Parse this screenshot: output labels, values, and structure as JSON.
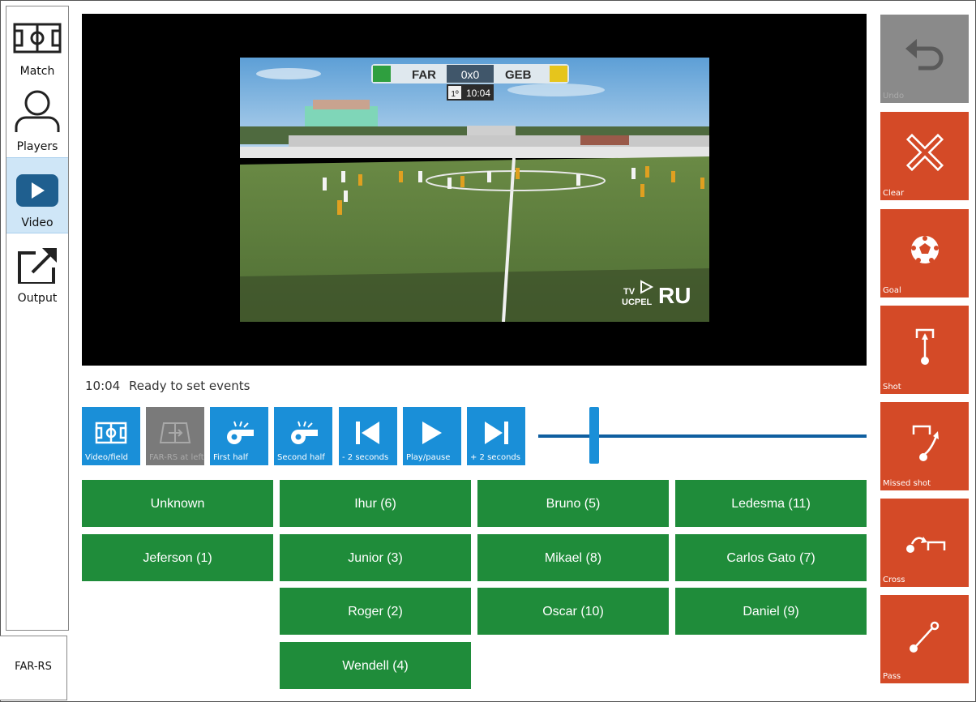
{
  "nav": {
    "items": [
      {
        "label": "Match",
        "icon": "field-icon"
      },
      {
        "label": "Players",
        "icon": "person-icon"
      },
      {
        "label": "Video",
        "icon": "play-icon"
      },
      {
        "label": "Output",
        "icon": "export-icon"
      }
    ],
    "team": "FAR-RS"
  },
  "scoreboard": {
    "home": "FAR",
    "score": "0x0",
    "away": "GEB",
    "period": "1º",
    "clock": "10:04"
  },
  "watermark": {
    "tv": "TV",
    "ucpel": "UCPEL",
    "ru": "RU"
  },
  "status": {
    "time": "10:04",
    "message": "Ready to set events"
  },
  "toolbar": [
    {
      "label": "Video/field",
      "icon": "field-icon",
      "enabled": true
    },
    {
      "label": "FAR-RS at left",
      "icon": "field-arrow-icon",
      "enabled": false
    },
    {
      "label": "First half",
      "icon": "whistle-icon",
      "enabled": true
    },
    {
      "label": "Second half",
      "icon": "whistle-icon",
      "enabled": true
    },
    {
      "label": "- 2 seconds",
      "icon": "skip-back-icon",
      "enabled": true
    },
    {
      "label": "Play/pause",
      "icon": "play-icon",
      "enabled": true
    },
    {
      "label": "+ 2 seconds",
      "icon": "skip-forward-icon",
      "enabled": true
    }
  ],
  "slider": {
    "position": 0.17
  },
  "players": [
    "Unknown",
    "Ihur (6)",
    "Bruno (5)",
    "Ledesma (11)",
    "Jeferson (1)",
    "Junior (3)",
    "Mikael (8)",
    "Carlos Gato (7)",
    "Roger (2)",
    "Oscar (10)",
    "Daniel (9)",
    "Wendell (4)"
  ],
  "events": [
    {
      "label": "Undo",
      "icon": "undo-icon",
      "enabled": false
    },
    {
      "label": "Clear",
      "icon": "close-icon",
      "enabled": true
    },
    {
      "label": "Goal",
      "icon": "ball-icon",
      "enabled": true
    },
    {
      "label": "Shot",
      "icon": "shot-icon",
      "enabled": true
    },
    {
      "label": "Missed shot",
      "icon": "missed-shot-icon",
      "enabled": true
    },
    {
      "label": "Cross",
      "icon": "cross-icon",
      "enabled": true
    },
    {
      "label": "Pass",
      "icon": "pass-icon",
      "enabled": true
    }
  ],
  "colors": {
    "accent_blue": "#1a8fd8",
    "player_green": "#1f8c3a",
    "event_orange": "#d44a27",
    "disabled_gray": "#8a8a8a"
  }
}
